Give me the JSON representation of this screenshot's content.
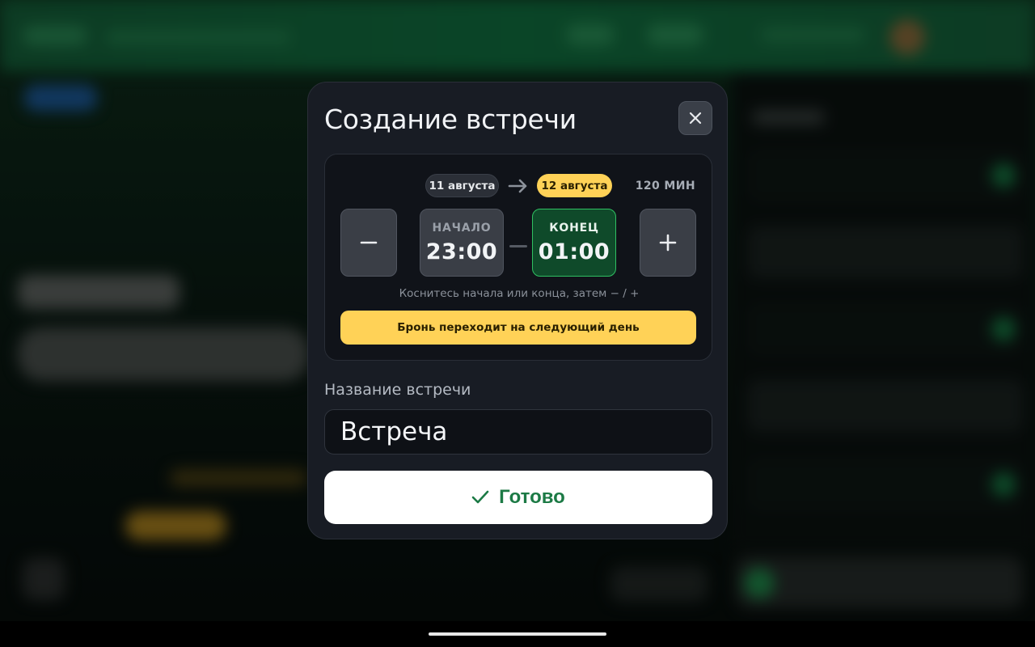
{
  "modal": {
    "title": "Создание встречи",
    "close_icon": "close-icon"
  },
  "booking": {
    "start_date": "11 августа",
    "end_date": "12 августа",
    "duration": "120 МИН",
    "start_label": "НАЧАЛО",
    "start_time": "23:00",
    "end_label": "КОНЕЦ",
    "end_time": "01:00",
    "hint": "Коснитесь начала или конца, затем − / +",
    "overnight_notice": "Бронь переходит на следующий день",
    "decrease_icon": "minus-icon",
    "increase_icon": "plus-icon",
    "selected": "end"
  },
  "meeting": {
    "name_label": "Название встречи",
    "name_value": "Встреча"
  },
  "actions": {
    "done_label": "Готово",
    "done_icon": "check-icon"
  },
  "colors": {
    "accent_green": "#2fc062",
    "done_text": "#1c7a45",
    "warning_yellow": "#ffd257",
    "modal_bg": "#181c24"
  }
}
